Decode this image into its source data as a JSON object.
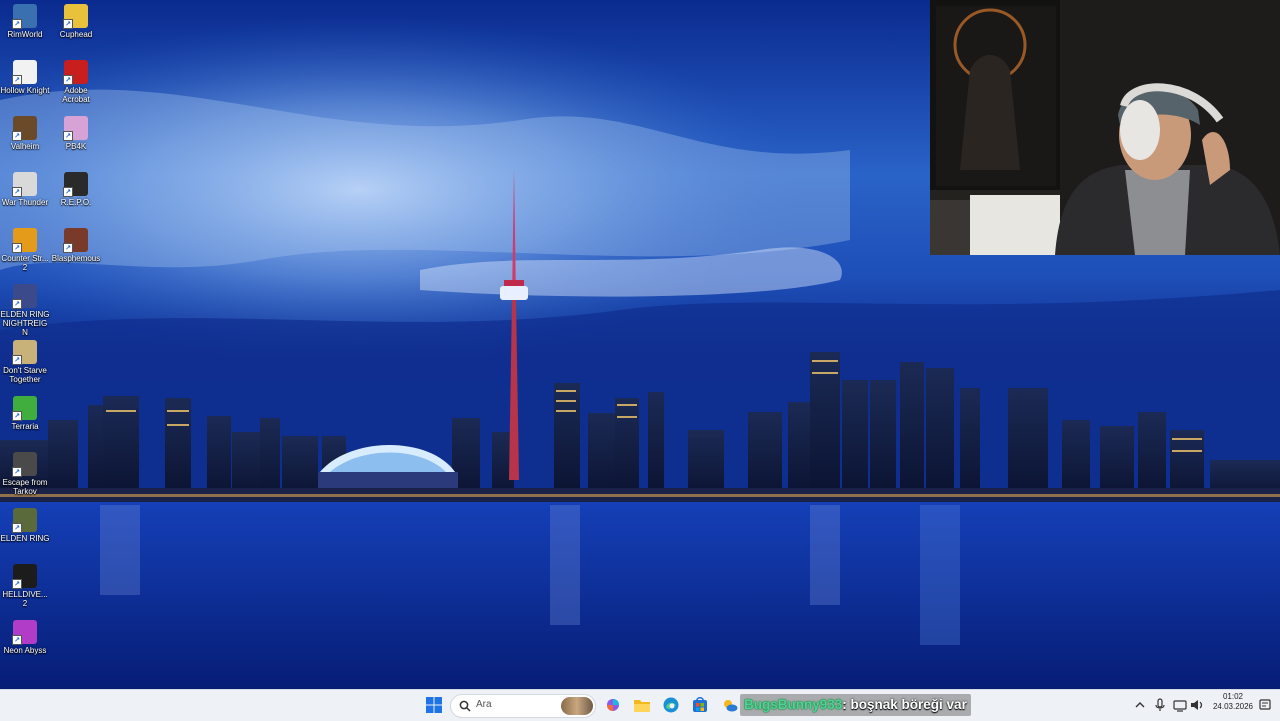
{
  "desktop": {
    "icons_col1": [
      {
        "label": "RimWorld",
        "icon": "rimworld-icon",
        "color": "#3a6fb0"
      },
      {
        "label": "Hollow Knight",
        "icon": "hollow-knight-icon",
        "color": "#f2f2f2"
      },
      {
        "label": "Valheim",
        "icon": "valheim-icon",
        "color": "#6b4a2a"
      },
      {
        "label": "War Thunder",
        "icon": "war-thunder-icon",
        "color": "#d9d9d9"
      },
      {
        "label": "Counter Str... 2",
        "icon": "counter-strike-icon",
        "color": "#e49b1a"
      },
      {
        "label": "ELDEN RING NIGHTREIGN",
        "icon": "elden-ring-nightreign-icon",
        "color": "#3a4a8a"
      },
      {
        "label": "Don't Starve Together",
        "icon": "dont-starve-icon",
        "color": "#c8b27a"
      },
      {
        "label": "Terraria",
        "icon": "terraria-icon",
        "color": "#3fae3f"
      },
      {
        "label": "Escape from Tarkov",
        "icon": "tarkov-icon",
        "color": "#4a4a4a"
      },
      {
        "label": "ELDEN RING",
        "icon": "elden-ring-icon",
        "color": "#5a6a3a"
      },
      {
        "label": "HELLDIVE... 2",
        "icon": "helldivers-icon",
        "color": "#1c1c1c"
      },
      {
        "label": "Neon Abyss",
        "icon": "neon-abyss-icon",
        "color": "#b03cc8"
      }
    ],
    "icons_col2": [
      {
        "label": "Cuphead",
        "icon": "cuphead-icon",
        "color": "#e8c23a"
      },
      {
        "label": "Adobe Acrobat",
        "icon": "adobe-acrobat-icon",
        "color": "#c81e1e"
      },
      {
        "label": "PB4K",
        "icon": "pb4k-icon",
        "color": "#d7a3d6"
      },
      {
        "label": "R.E.P.O.",
        "icon": "repo-icon",
        "color": "#2a2a2a"
      },
      {
        "label": "Blasphemous",
        "icon": "blasphemous-icon",
        "color": "#7a3a2a"
      }
    ]
  },
  "taskbar": {
    "search_placeholder": "Ara",
    "apps": [
      "start-icon",
      "copilot-icon",
      "file-explorer-icon",
      "edge-icon",
      "store-icon",
      "weather-icon"
    ],
    "tray": [
      "chevron-up-icon",
      "microphone-icon",
      "network-icon",
      "volume-icon"
    ],
    "time": "01:02",
    "date": "24.03.2026"
  },
  "chat": {
    "username": "BugsBunny933",
    "separator": ": ",
    "message": "boşnak böreği var"
  },
  "colors": {
    "sky_top": "#06207e",
    "sky_glow": "#8fb8ea",
    "water": "#0a2fa6",
    "taskbar": "#eef1f6",
    "chat_user": "#4fd39b"
  }
}
